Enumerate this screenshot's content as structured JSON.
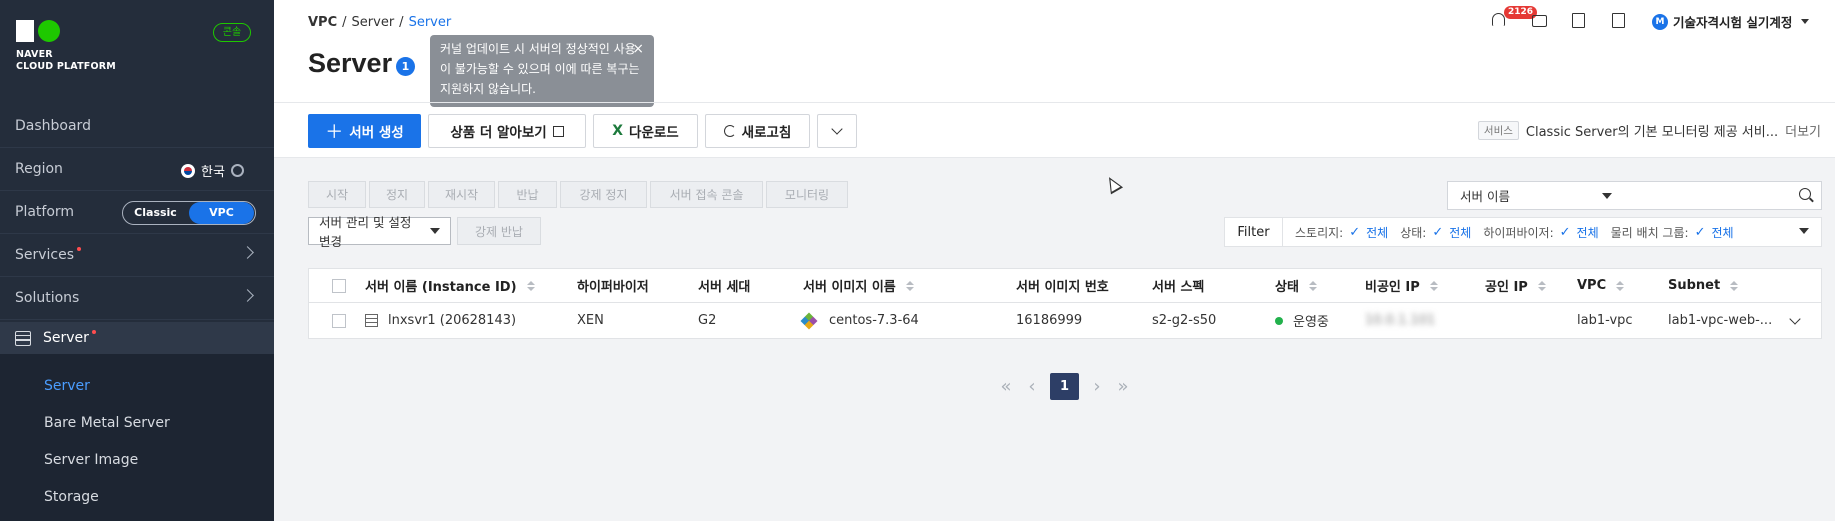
{
  "brand": {
    "line1": "NAVER",
    "line2": "CLOUD PLATFORM",
    "console_badge": "콘솔"
  },
  "sidebar": {
    "dashboard": "Dashboard",
    "region": {
      "label": "Region",
      "value": "한국"
    },
    "platform": {
      "label": "Platform",
      "options": [
        "Classic",
        "VPC"
      ],
      "selected": "VPC"
    },
    "services": "Services",
    "solutions": "Solutions",
    "server": "Server",
    "sub_items": [
      "Server",
      "Bare Metal Server",
      "Server Image",
      "Storage"
    ]
  },
  "breadcrumb": {
    "first": "VPC",
    "sep1": "/",
    "second": "Server",
    "sep2": "/",
    "current": "Server"
  },
  "header": {
    "title": "Server",
    "count": "1",
    "notification_count": "2126",
    "user_initial": "M",
    "user_name": "기술자격시험 실기계정"
  },
  "tooltip": {
    "text": "커널 업데이트 시 서버의 정상적인 사용이 불가능할 수 있으며 이에 따른 복구는 지원하지 않습니다.",
    "close": "×"
  },
  "toolbar": {
    "create": "서버 생성",
    "learn_more": "상품 더 알아보기",
    "download": "다운로드",
    "refresh": "새로고침"
  },
  "service_note": {
    "tag": "서비스",
    "text": "Classic Server의 기본 모니터링 제공 서비...",
    "more": "더보기"
  },
  "actions": [
    "시작",
    "정지",
    "재시작",
    "반납",
    "강제 정지",
    "서버 접속 콘솔",
    "모니터링"
  ],
  "management": {
    "select": "서버 관리 및 설정 변경",
    "force_return": "강제 반납"
  },
  "search": {
    "field": "서버 이름",
    "value": ""
  },
  "filter": {
    "label": "Filter",
    "groups": [
      {
        "name": "스토리지:",
        "value": "전체"
      },
      {
        "name": "상태:",
        "value": "전체"
      },
      {
        "name": "하이퍼바이저:",
        "value": "전체"
      },
      {
        "name": "물리 배치 그룹:",
        "value": "전체"
      }
    ]
  },
  "table": {
    "columns": [
      "서버 이름 (Instance ID)",
      "하이퍼바이저",
      "서버 세대",
      "서버 이미지 이름",
      "서버 이미지 번호",
      "서버 스펙",
      "상태",
      "비공인 IP",
      "공인 IP",
      "VPC",
      "Subnet"
    ],
    "rows": [
      {
        "name": "lnxsvr1 (20628143)",
        "hypervisor": "XEN",
        "generation": "G2",
        "image_name": "centos-7.3-64",
        "image_no": "16186999",
        "spec": "s2-g2-s50",
        "status": "운영중",
        "private_ip": "10.0.1.101",
        "public_ip": "",
        "vpc": "lab1-vpc",
        "subnet": "lab1-vpc-web-..."
      }
    ]
  },
  "pagination": {
    "current": "1"
  },
  "colors": {
    "primary": "#1a73e8",
    "sidebar_bg": "#242d3b",
    "status_running": "#22b14c"
  }
}
